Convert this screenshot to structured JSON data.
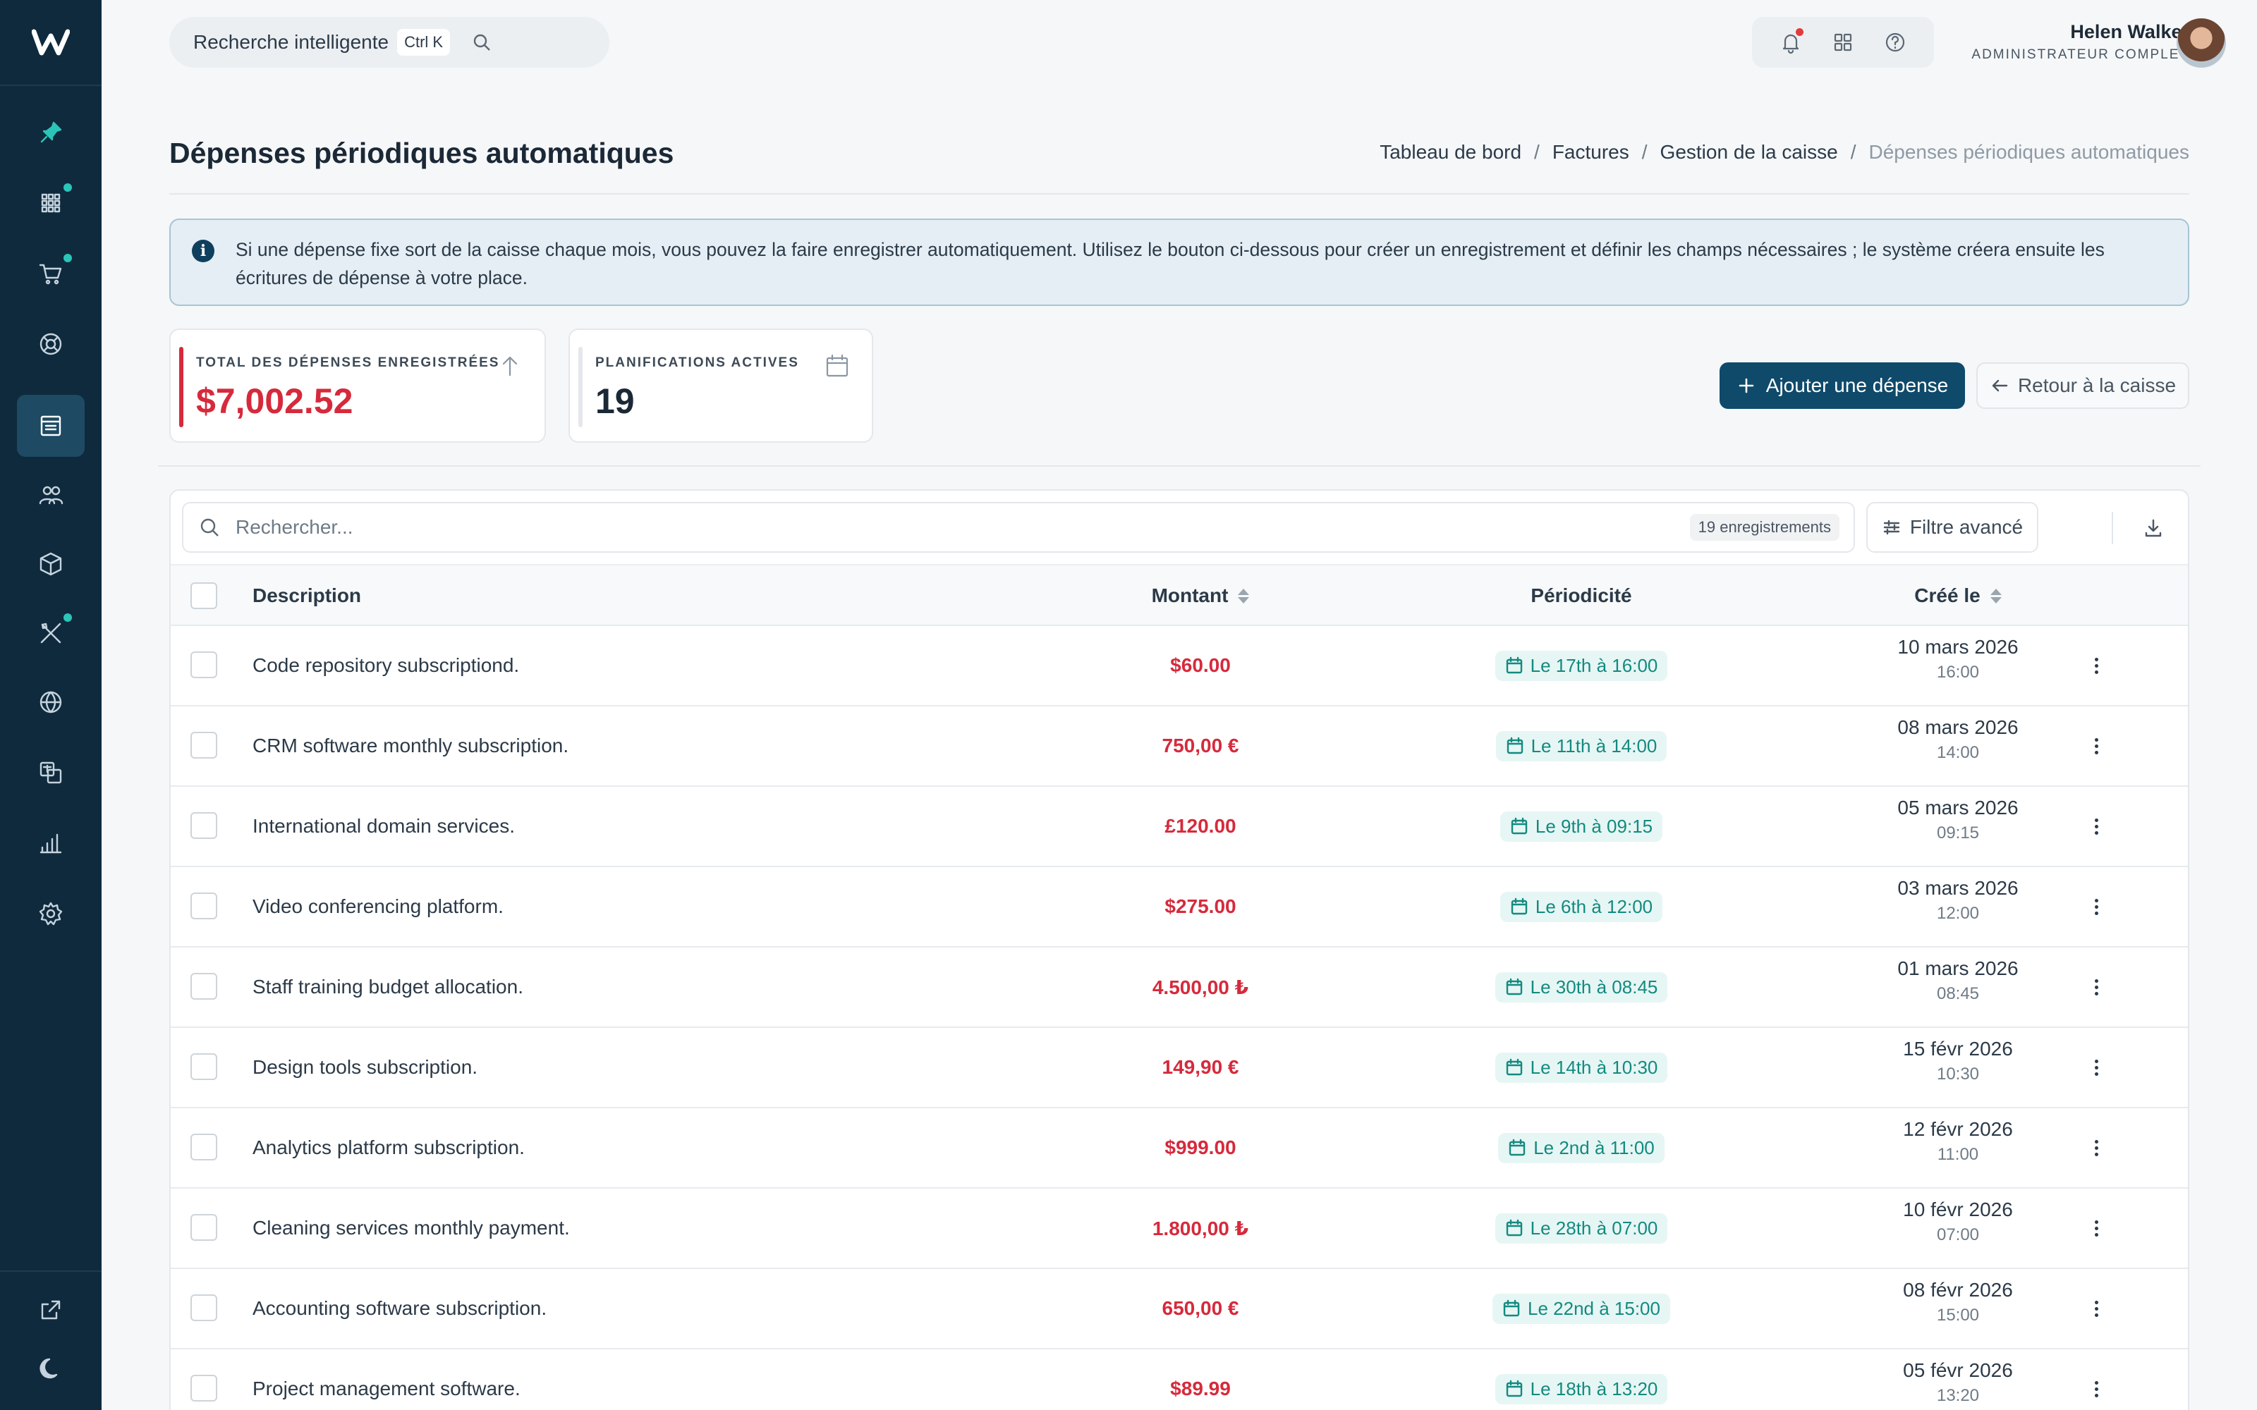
{
  "topbar": {
    "search_label": "Recherche intelligente",
    "search_shortcut": "Ctrl K",
    "user_name": "Helen Walker",
    "user_role": "ADMINISTRATEUR COMPLET"
  },
  "sidebar": {
    "items": [
      {
        "icon": "pin-icon"
      },
      {
        "icon": "grid-icon",
        "badge": true
      },
      {
        "icon": "cart-icon",
        "badge": true
      },
      {
        "icon": "lifebuoy-icon"
      },
      {
        "icon": "cashbox-icon",
        "active": true
      },
      {
        "icon": "users-icon"
      },
      {
        "icon": "box-icon"
      },
      {
        "icon": "tools-icon",
        "badge": true
      },
      {
        "icon": "globe-icon"
      },
      {
        "icon": "translate-icon"
      },
      {
        "icon": "chart-icon"
      },
      {
        "icon": "settings-icon"
      }
    ],
    "bottom": [
      {
        "icon": "external-link-icon"
      },
      {
        "icon": "moon-icon"
      }
    ]
  },
  "page": {
    "title": "Dépenses périodiques automatiques",
    "breadcrumb": [
      "Tableau de bord",
      "Factures",
      "Gestion de la caisse",
      "Dépenses périodiques automatiques"
    ]
  },
  "alert": {
    "text": "Si une dépense fixe sort de la caisse chaque mois, vous pouvez la faire enregistrer automatiquement. Utilisez le bouton ci-dessous pour créer un enregistrement et définir les champs nécessaires ; le système créera ensuite les écritures de dépense à votre place."
  },
  "stats": {
    "total_label": "TOTAL DES DÉPENSES ENREGISTRÉES",
    "total_value": "$7,002.52",
    "active_label": "PLANIFICATIONS ACTIVES",
    "active_value": "19"
  },
  "actions": {
    "add_label": "Ajouter une dépense",
    "back_label": "Retour à la caisse"
  },
  "table": {
    "search_placeholder": "Rechercher...",
    "record_count": "19 enregistrements",
    "filter_label": "Filtre avancé",
    "columns": {
      "description": "Description",
      "amount": "Montant",
      "period": "Périodicité",
      "created": "Créé le"
    },
    "rows": [
      {
        "description": "Code repository subscriptiond.",
        "amount": "$60.00",
        "period": "Le 17th à 16:00",
        "date": "10 mars 2026",
        "time": "16:00"
      },
      {
        "description": "CRM software monthly subscription.",
        "amount": "750,00 €",
        "period": "Le 11th à 14:00",
        "date": "08 mars 2026",
        "time": "14:00"
      },
      {
        "description": "International domain services.",
        "amount": "£120.00",
        "period": "Le 9th à 09:15",
        "date": "05 mars 2026",
        "time": "09:15"
      },
      {
        "description": "Video conferencing platform.",
        "amount": "$275.00",
        "period": "Le 6th à 12:00",
        "date": "03 mars 2026",
        "time": "12:00"
      },
      {
        "description": "Staff training budget allocation.",
        "amount": "4.500,00 ₺",
        "period": "Le 30th à 08:45",
        "date": "01 mars 2026",
        "time": "08:45"
      },
      {
        "description": "Design tools subscription.",
        "amount": "149,90 €",
        "period": "Le 14th à 10:30",
        "date": "15 févr 2026",
        "time": "10:30"
      },
      {
        "description": "Analytics platform subscription.",
        "amount": "$999.00",
        "period": "Le 2nd à 11:00",
        "date": "12 févr 2026",
        "time": "11:00"
      },
      {
        "description": "Cleaning services monthly payment.",
        "amount": "1.800,00 ₺",
        "period": "Le 28th à 07:00",
        "date": "10 févr 2026",
        "time": "07:00"
      },
      {
        "description": "Accounting software subscription.",
        "amount": "650,00 €",
        "period": "Le 22nd à 15:00",
        "date": "08 févr 2026",
        "time": "15:00"
      },
      {
        "description": "Project management software.",
        "amount": "$89.99",
        "period": "Le 18th à 13:20",
        "date": "05 févr 2026",
        "time": "13:20"
      }
    ]
  },
  "colors": {
    "sidebar": "#0f2a3d",
    "primary": "#0f4a6b",
    "amount": "#d62a3c",
    "badge": "#138a80"
  }
}
